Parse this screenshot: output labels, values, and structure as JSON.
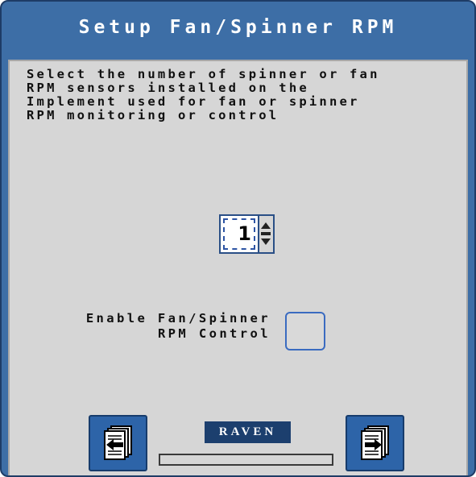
{
  "window": {
    "title": "Setup Fan/Spinner RPM"
  },
  "instruction": "Select the number of spinner or fan\nRPM sensors installed on the\nImplement used for fan or spinner\nRPM monitoring or control",
  "sensor_count": {
    "value": "1"
  },
  "enable_control": {
    "label": "Enable Fan/Spinner\nRPM Control",
    "checked": false
  },
  "logo": {
    "text": "RAVEN"
  },
  "navigation": {
    "back_icon": "page-back-icon",
    "next_icon": "page-next-icon",
    "progress": 0
  },
  "colors": {
    "frame": "#3d6ea6",
    "panel": "#d6d6d6",
    "button": "#2d64a8",
    "logo_bg": "#1c3f6e"
  }
}
